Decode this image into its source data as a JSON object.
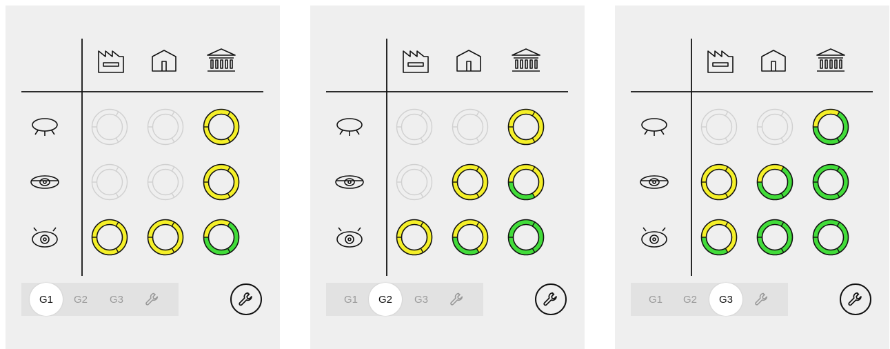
{
  "columns": [
    {
      "id": "factory",
      "icon": "factory-icon"
    },
    {
      "id": "house",
      "icon": "house-icon"
    },
    {
      "id": "institution",
      "icon": "institution-icon"
    }
  ],
  "rows": [
    {
      "id": "eye-closed",
      "icon": "eye-closed-icon"
    },
    {
      "id": "eye-half",
      "icon": "eye-half-open-icon"
    },
    {
      "id": "eye-open",
      "icon": "eye-open-icon"
    }
  ],
  "colors": {
    "yellow": "#f5f029",
    "green": "#42dc3a",
    "inactive": "#d0d0d0",
    "outline": "#111111",
    "panel": "#efefef"
  },
  "panels": [
    {
      "tabs": [
        {
          "label": "G1"
        },
        {
          "label": "G2"
        },
        {
          "label": "G3"
        }
      ],
      "selected": 0,
      "matrix": [
        [
          {
            "state": "inactive"
          },
          {
            "state": "inactive"
          },
          {
            "state": "ring",
            "green_fraction": 0
          }
        ],
        [
          {
            "state": "inactive"
          },
          {
            "state": "inactive"
          },
          {
            "state": "ring",
            "green_fraction": 0
          }
        ],
        [
          {
            "state": "ring",
            "green_fraction": 0
          },
          {
            "state": "ring",
            "green_fraction": 0
          },
          {
            "state": "ring",
            "green_fraction": 0.67
          }
        ]
      ]
    },
    {
      "tabs": [
        {
          "label": "G1"
        },
        {
          "label": "G2"
        },
        {
          "label": "G3"
        }
      ],
      "selected": 1,
      "matrix": [
        [
          {
            "state": "inactive"
          },
          {
            "state": "inactive"
          },
          {
            "state": "ring",
            "green_fraction": 0
          }
        ],
        [
          {
            "state": "inactive"
          },
          {
            "state": "ring",
            "green_fraction": 0
          },
          {
            "state": "ring",
            "green_fraction": 0.33
          }
        ],
        [
          {
            "state": "ring",
            "green_fraction": 0
          },
          {
            "state": "ring",
            "green_fraction": 0.33
          },
          {
            "state": "ring",
            "green_fraction": 1
          }
        ]
      ]
    },
    {
      "tabs": [
        {
          "label": "G1"
        },
        {
          "label": "G2"
        },
        {
          "label": "G3"
        }
      ],
      "selected": 2,
      "matrix": [
        [
          {
            "state": "inactive"
          },
          {
            "state": "inactive"
          },
          {
            "state": "ring",
            "green_fraction": 0.67
          }
        ],
        [
          {
            "state": "ring",
            "green_fraction": 0
          },
          {
            "state": "ring",
            "green_fraction": 0.67
          },
          {
            "state": "ring",
            "green_fraction": 1
          }
        ],
        [
          {
            "state": "ring",
            "green_fraction": 0.33
          },
          {
            "state": "ring",
            "green_fraction": 1
          },
          {
            "state": "ring",
            "green_fraction": 1
          }
        ]
      ]
    }
  ]
}
